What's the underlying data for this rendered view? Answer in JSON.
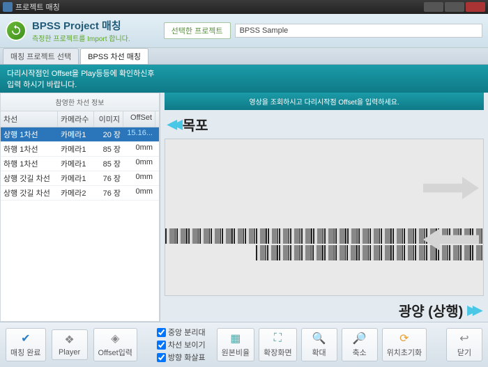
{
  "window": {
    "title": "프로젝트 매칭"
  },
  "header": {
    "main": "BPSS Project 매칭",
    "sub": "측정한 프로젝트를 Import 합니다.",
    "select_btn": "선택한 프로젝트",
    "project_name": "BPSS Sample"
  },
  "tabs": {
    "t1": "매칭 프로젝트 선택",
    "t2": "BPSS 차선 매칭"
  },
  "teal_bar": {
    "left": "다리시작점인 Offset을 Play등등에 확인하신후 입력 하시기 바랍니다.",
    "right": ""
  },
  "left_panel": {
    "title": "참영한 차선 정보",
    "cols": {
      "c1": "차선",
      "c2": "카메라수",
      "c3": "이미지",
      "c4": "OffSet"
    },
    "rows": [
      {
        "c1": "상행 1차선",
        "c2": "카메라1",
        "c3": "20 장",
        "c4": "15.16..."
      },
      {
        "c1": "하행 1차선",
        "c2": "카메라1",
        "c3": "85 장",
        "c4": "0mm"
      },
      {
        "c1": "하행 1차선",
        "c2": "카메라1",
        "c3": "85 장",
        "c4": "0mm"
      },
      {
        "c1": "상행 갓길 차선",
        "c2": "카메라1",
        "c3": "76 장",
        "c4": "0mm"
      },
      {
        "c1": "상행 갓길 차선",
        "c2": "카메라2",
        "c3": "76 장",
        "c4": "0mm"
      }
    ]
  },
  "right_panel": {
    "head": "영상을 조회하시고 다리시작점 Offset을 입력하세요.",
    "dir_left": "목포",
    "dir_right": "광양 (상행)"
  },
  "footer": {
    "complete": "매칭 완료",
    "player": "Player",
    "offset": "Offset입력",
    "chk1": "중앙 분리대",
    "chk2": "차선 보이기",
    "chk3": "방향 화살표",
    "b1": "원본비율",
    "b2": "확장화면",
    "b3": "확대",
    "b4": "축소",
    "b5": "위치초기화",
    "close": "닫기"
  }
}
